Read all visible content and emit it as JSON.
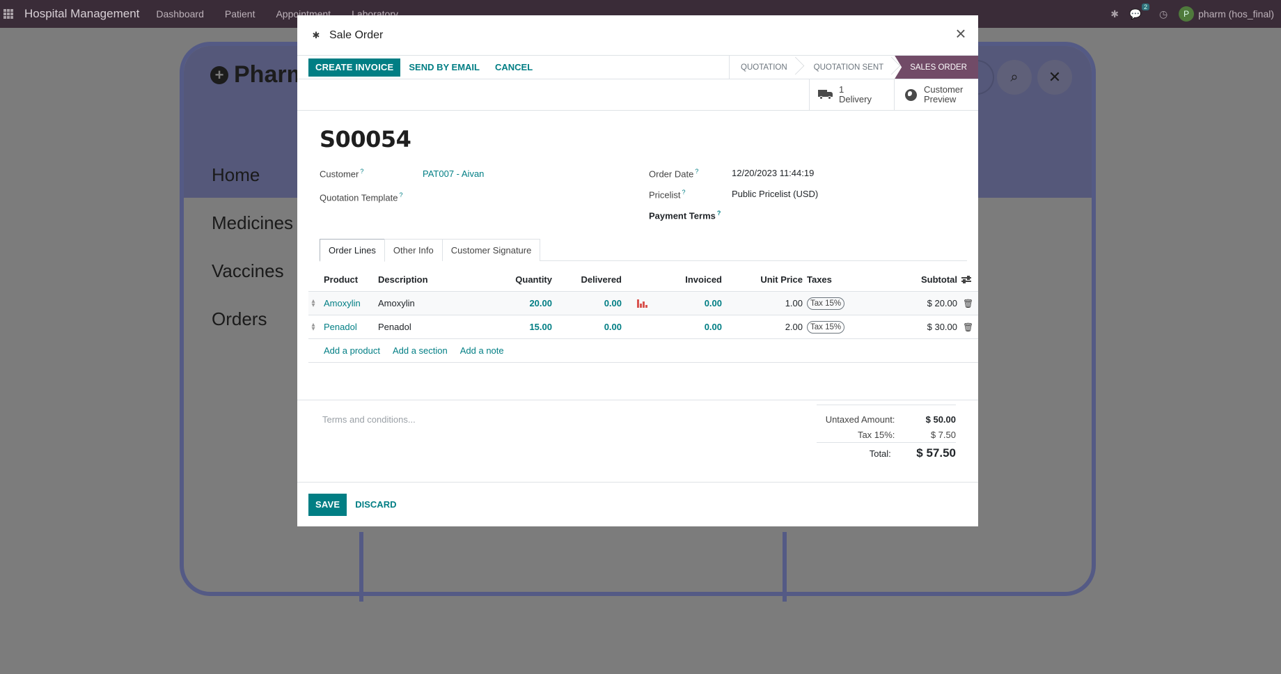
{
  "app": {
    "name": "Hospital Management",
    "menu": [
      "Dashboard",
      "Patient",
      "Appointment",
      "Laboratory"
    ],
    "chat_count": "2",
    "user_initial": "P",
    "user_name": "pharm (hos_final)"
  },
  "background": {
    "title": "Pharm",
    "nav": [
      "Home",
      "Medicines",
      "Vaccines",
      "Orders"
    ]
  },
  "modal": {
    "title": "Sale Order",
    "actions": {
      "create_invoice": "CREATE INVOICE",
      "send_by_email": "SEND BY EMAIL",
      "cancel": "CANCEL"
    },
    "stages": [
      "QUOTATION",
      "QUOTATION SENT",
      "SALES ORDER"
    ],
    "active_stage": "SALES ORDER",
    "smart_buttons": {
      "delivery_count": "1",
      "delivery_label": "Delivery",
      "preview_line1": "Customer",
      "preview_line2": "Preview"
    },
    "order_name": "S00054",
    "fields": {
      "customer_label": "Customer",
      "customer_value": "PAT007 - Aivan",
      "quotation_template_label": "Quotation Template",
      "order_date_label": "Order Date",
      "order_date_value": "12/20/2023 11:44:19",
      "pricelist_label": "Pricelist",
      "pricelist_value": "Public Pricelist (USD)",
      "payment_terms_label": "Payment Terms",
      "help_mark": "?"
    },
    "tabs": [
      "Order Lines",
      "Other Info",
      "Customer Signature"
    ],
    "order_lines": {
      "headers": {
        "product": "Product",
        "description": "Description",
        "quantity": "Quantity",
        "delivered": "Delivered",
        "invoiced": "Invoiced",
        "unit_price": "Unit Price",
        "taxes": "Taxes",
        "subtotal": "Subtotal"
      },
      "rows": [
        {
          "product": "Amoxylin",
          "description": "Amoxylin",
          "quantity": "20.00",
          "delivered": "0.00",
          "invoiced": "0.00",
          "unit_price": "1.00",
          "tax": "Tax 15%",
          "subtotal": "$ 20.00"
        },
        {
          "product": "Penadol",
          "description": "Penadol",
          "quantity": "15.00",
          "delivered": "0.00",
          "invoiced": "0.00",
          "unit_price": "2.00",
          "tax": "Tax 15%",
          "subtotal": "$ 30.00"
        }
      ],
      "add_links": {
        "product": "Add a product",
        "section": "Add a section",
        "note": "Add a note"
      }
    },
    "terms_placeholder": "Terms and conditions...",
    "totals": {
      "untaxed_label": "Untaxed Amount:",
      "untaxed_value": "$ 50.00",
      "tax_label": "Tax 15%:",
      "tax_value": "$ 7.50",
      "total_label": "Total:",
      "total_value": "$ 57.50"
    },
    "footer": {
      "save": "SAVE",
      "discard": "DISCARD"
    }
  },
  "colors": {
    "primary": "#017e84",
    "active_stage": "#714b67",
    "topbar": "#3a2c38"
  }
}
